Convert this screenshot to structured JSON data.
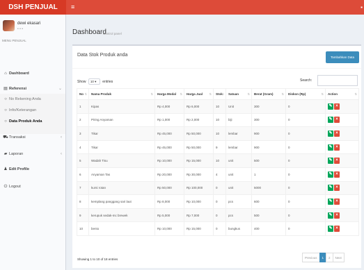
{
  "header": {
    "brand": "DSH PENJUAL",
    "toggle_icon": "hamburger-icon"
  },
  "user": {
    "name": "dewi ekasari",
    "status": "• • •"
  },
  "sidebar": {
    "menu_header": "MENU PENJUAL",
    "items": [
      {
        "icon": "home-icon",
        "label": "Dashboard"
      },
      {
        "icon": "list-icon",
        "label": "Referensi"
      },
      {
        "icon": "circle-icon",
        "label": "No Rekening Anda"
      },
      {
        "icon": "circle-icon",
        "label": "Info/Keterangan"
      },
      {
        "icon": "circle-icon",
        "label": "Data Produk Anda"
      },
      {
        "icon": "cart-icon",
        "label": "Transaksi"
      },
      {
        "icon": "chart-icon",
        "label": "Laporan"
      },
      {
        "icon": "user-icon",
        "label": "Edit Profile"
      },
      {
        "icon": "power-icon",
        "label": "Logout"
      }
    ]
  },
  "page": {
    "title": "Dashboard",
    "subtitle": "Control panel"
  },
  "box": {
    "title": "Data Stok Produk anda",
    "add_button": "Tambahkan Data",
    "show_label": "Show",
    "entries_value": "10",
    "entries_label": "entries",
    "search_label": "Search:",
    "info": "Showing 1 to 10 of 18 entries"
  },
  "table": {
    "columns": [
      "No",
      "Nama Produk",
      "Harga Modal",
      "Harga Jual",
      "Stok",
      "Satuan",
      "Berat (Gram)",
      "Diskon (Rp)",
      "Action"
    ],
    "rows": [
      [
        "1",
        "Kipas",
        "Rp 4,000",
        "Rp 6,000",
        "10",
        "Unit",
        "300",
        "0"
      ],
      [
        "2",
        "Piring Anyaman",
        "Rp 1,000",
        "Rp 2,000",
        "10",
        "biji",
        "300",
        "0"
      ],
      [
        "3",
        "Tikar",
        "Rp 45,000",
        "Rp 50,000",
        "10",
        "lembar",
        "900",
        "0"
      ],
      [
        "4",
        "Tikar",
        "Rp 45,000",
        "Rp 50,000",
        "9",
        "lembar",
        "900",
        "0"
      ],
      [
        "5",
        "Wadah Tisu",
        "Rp 10,000",
        "Rp 15,000",
        "10",
        "unit",
        "500",
        "0"
      ],
      [
        "6",
        "Anyaman Tas",
        "Rp 20,000",
        "Rp 30,000",
        "4",
        "unit",
        "1",
        "0"
      ],
      [
        "7",
        "kursi rotan",
        "Rp 50,000",
        "Rp 100,000",
        "0",
        "unit",
        "5000",
        "0"
      ],
      [
        "8",
        "kemplang panggang sari laut",
        "Rp 8,000",
        "Rp 10,000",
        "0",
        "pcs",
        "600",
        "0"
      ],
      [
        "9",
        "kerupuk sedak-mc brewek",
        "Rp 5,000",
        "Rp 7,000",
        "0",
        "pcs",
        "500",
        "0"
      ],
      [
        "10",
        "bento",
        "Rp 10,000",
        "Rp 15,000",
        "0",
        "bungkus",
        "400",
        "0"
      ]
    ]
  },
  "pagination": {
    "previous": "Previous",
    "pages": [
      "1",
      "2"
    ],
    "next": "Next"
  },
  "colors": {
    "header": "#dd4b39",
    "primary": "#3c8dbc",
    "edit": "#00a65a",
    "delete": "#dd4b39"
  }
}
